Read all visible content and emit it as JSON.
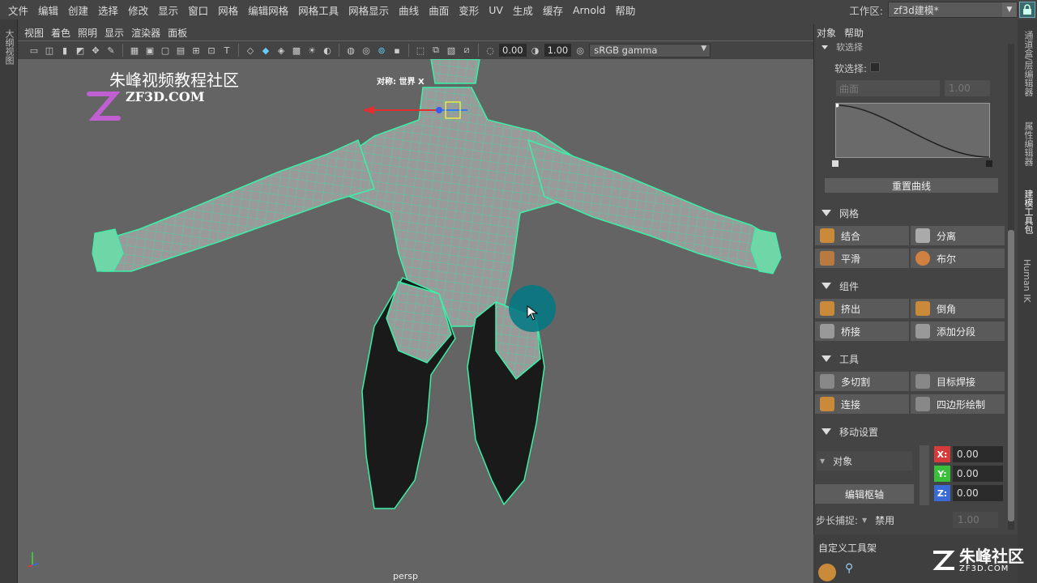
{
  "menu": [
    "文件",
    "编辑",
    "创建",
    "选择",
    "修改",
    "显示",
    "窗口",
    "网格",
    "编辑网格",
    "网格工具",
    "网格显示",
    "曲线",
    "曲面",
    "变形",
    "UV",
    "生成",
    "缓存",
    "Arnold",
    "帮助"
  ],
  "workspace": {
    "label": "工作区:",
    "value": "zf3d建模*"
  },
  "left_tab": "大纲视图",
  "viewport": {
    "menu": [
      "视图",
      "着色",
      "照明",
      "显示",
      "渲染器",
      "面板"
    ],
    "field_a": "0.00",
    "field_b": "1.00",
    "color_space": "sRGB gamma",
    "camera": "persp",
    "pivot_label": "对称: 世界 X",
    "watermark_title": "朱峰视频教程社区",
    "watermark_url": "ZF3D.COM"
  },
  "panel": {
    "menu": [
      "对象",
      "帮助"
    ],
    "soft_select_head": "软选择",
    "soft_select_label": "软选择:",
    "falloff_mode": "曲面",
    "falloff_value": "1.00",
    "reset_curve": "重置曲线",
    "sections": {
      "mesh": "网格",
      "components": "组件",
      "tools": "工具",
      "move": "移动设置",
      "shelf": "自定义工具架"
    },
    "mesh_buttons": [
      "结合",
      "分离",
      "平滑",
      "布尔"
    ],
    "component_buttons": [
      "挤出",
      "倒角",
      "桥接",
      "添加分段"
    ],
    "tool_buttons": [
      "多切割",
      "目标焊接",
      "连接",
      "四边形绘制"
    ],
    "move": {
      "space": "对象",
      "edit_pivot": "编辑枢轴",
      "x": "0.00",
      "y": "0.00",
      "z": "0.00",
      "step_label": "步长捕捉:",
      "step_mode": "禁用",
      "step_value": "1.00"
    },
    "colors": {
      "x": "#d63a3a",
      "y": "#3abf3a",
      "z": "#3a6ad6"
    }
  },
  "right_tabs": [
    "通道盒/层编辑器",
    "属性编辑器",
    "建模工具包",
    "Human IK"
  ],
  "brand": {
    "name": "朱峰社区",
    "url": "ZF3D.COM"
  }
}
